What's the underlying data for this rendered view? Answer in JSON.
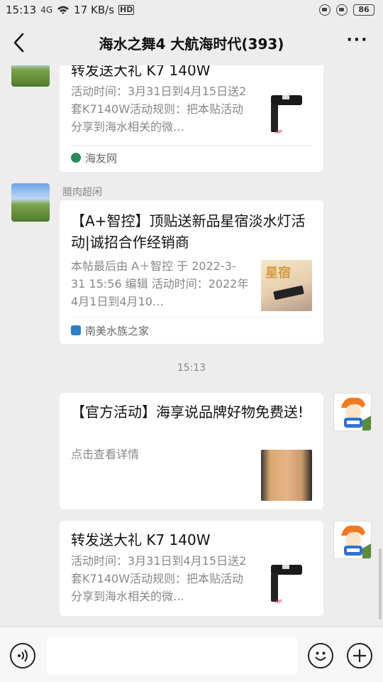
{
  "status_bar": {
    "time": "15:13",
    "network_speed": "17 KB/s",
    "hd_badge": "HD",
    "battery": "86",
    "signal_label": "4G"
  },
  "header": {
    "title": "海水之舞4 大航海时代(393)",
    "more_label": "···"
  },
  "messages": [
    {
      "title": "转发送大礼 K7 140W",
      "desc": "活动时间：3月31日到4月15日送2套K7140W活动规则：把本贴活动分享到海水相关的微…",
      "source": "海友网",
      "source_color": "#2a8a5a"
    },
    {
      "sender": "腊肉超闲",
      "title": "【A+智控】顶贴送新品星宿淡水灯活动|诚招合作经销商",
      "desc": " 本帖最后由 A＋智控 于 2022-3-31 15:56 编辑 活动时间：2022年4月1日到4月10…",
      "source": "南美水族之家",
      "source_color": "#2b7fc4",
      "thumb_text": "星宿"
    },
    {
      "title": "【官方活动】海享说品牌好物免费送!",
      "desc": "点击查看详情"
    },
    {
      "title": "转发送大礼 K7 140W",
      "desc": "活动时间：3月31日到4月15日送2套K7140W活动规则：把本贴活动分享到海水相关的微…"
    }
  ],
  "timestamp": "15:13",
  "colors": {
    "background": "#ededed",
    "card": "#ffffff",
    "title_text": "#111111",
    "desc_text": "#888888"
  }
}
